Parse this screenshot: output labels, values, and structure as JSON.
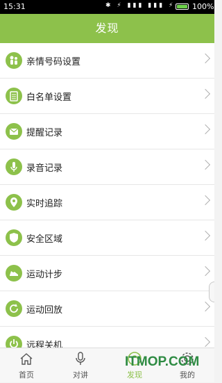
{
  "status_bar": {
    "time": "15:31",
    "battery_percent": "100%",
    "battery_level": 1.0
  },
  "header": {
    "title": "发现"
  },
  "menu": [
    {
      "label": "亲情号码设置",
      "icon": "family-icon"
    },
    {
      "label": "白名单设置",
      "icon": "clipboard-icon"
    },
    {
      "label": "提醒记录",
      "icon": "envelope-icon"
    },
    {
      "label": "录音记录",
      "icon": "microphone-icon"
    },
    {
      "label": "实时追踪",
      "icon": "location-pin-icon"
    },
    {
      "label": "安全区域",
      "icon": "shield-icon"
    },
    {
      "label": "运动计步",
      "icon": "sneaker-icon"
    },
    {
      "label": "运动回放",
      "icon": "replay-icon"
    },
    {
      "label": "远程关机",
      "icon": "power-icon"
    }
  ],
  "tabs": [
    {
      "label": "首页",
      "icon": "home-icon",
      "active": false
    },
    {
      "label": "对讲",
      "icon": "microphone-icon",
      "active": false
    },
    {
      "label": "发现",
      "icon": "discover-icon",
      "active": true
    },
    {
      "label": "我的",
      "icon": "gear-icon",
      "active": false
    }
  ],
  "watermark": "ITMOP.COM",
  "colors": {
    "accent": "#8dc14b",
    "watermark": "#2e8b43"
  }
}
